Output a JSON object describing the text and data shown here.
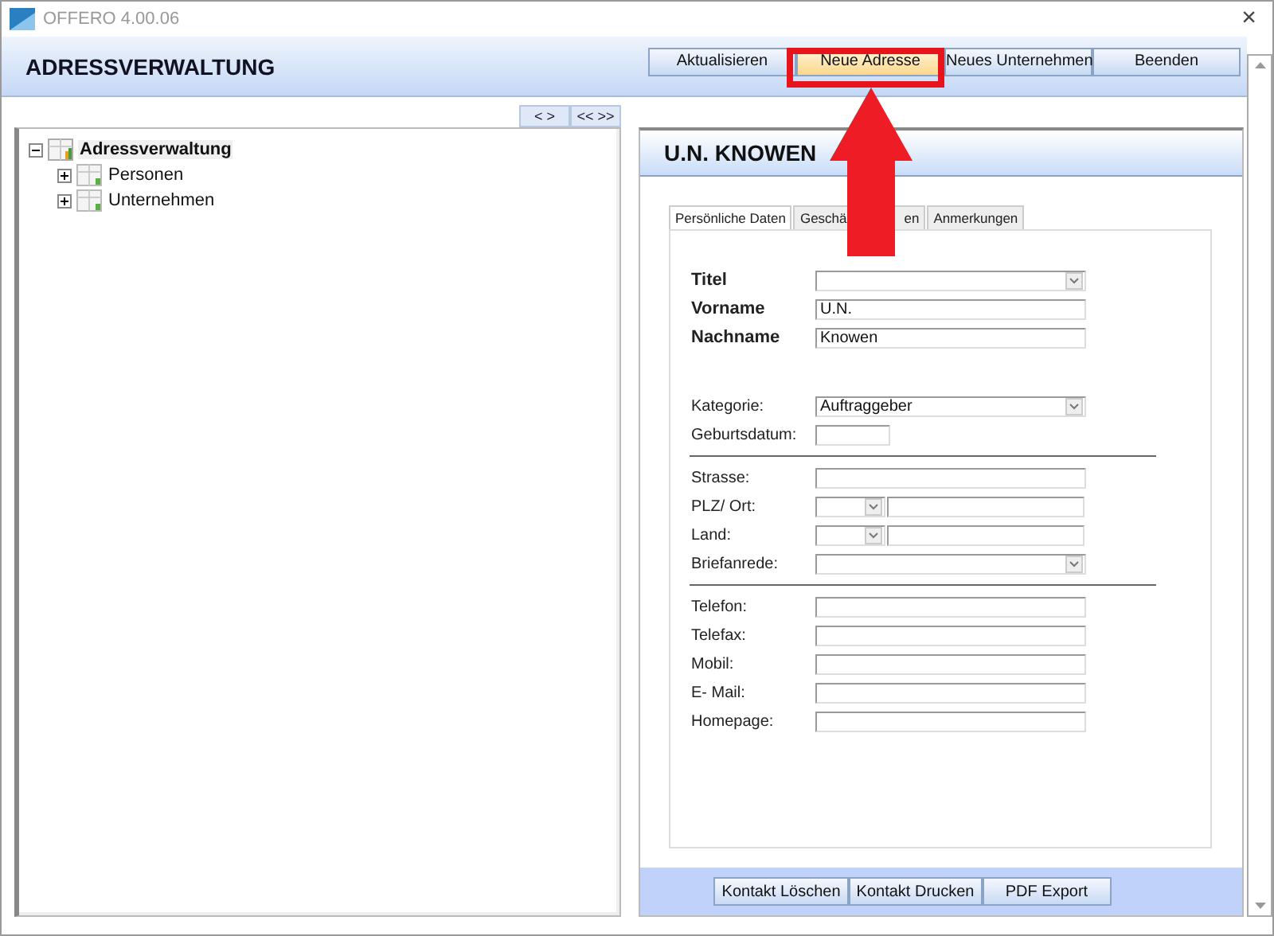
{
  "window": {
    "title": "OFFERO 4.00.06",
    "close": "×"
  },
  "header": {
    "title": "ADRESSVERWALTUNG"
  },
  "toolbar": [
    {
      "label": "Aktualisieren",
      "highlighted": false
    },
    {
      "label": "Neue Adresse",
      "highlighted": true
    },
    {
      "label": "Neues Unternehmen",
      "highlighted": false
    },
    {
      "label": "Beenden",
      "highlighted": false
    }
  ],
  "tree_buttons": [
    "< >",
    "<< >>"
  ],
  "tree": [
    {
      "label": "Adressverwaltung",
      "expanded": true,
      "selected": true,
      "children": [
        {
          "label": "Personen",
          "expanded": false,
          "selected": false
        },
        {
          "label": "Unternehmen",
          "expanded": false,
          "selected": false
        }
      ]
    }
  ],
  "detail": {
    "title": "U.N. KNOWEN",
    "tabs": [
      {
        "label": "Persönliche Daten",
        "selected": true
      },
      {
        "label": "Geschä",
        "label_end": "en",
        "selected": false
      },
      {
        "label": "Anmerkungen",
        "selected": false
      }
    ],
    "sections": [
      {
        "kind": "plain",
        "rows": [
          {
            "label": "Titel",
            "bold": true,
            "kind": "select"
          },
          {
            "label": "Vorname",
            "bold": true,
            "kind": "text",
            "value": "U.N."
          },
          {
            "label": "Nachname",
            "bold": true,
            "kind": "text",
            "value": "Knowen"
          }
        ]
      },
      {
        "kind": "spaced",
        "rows": [
          {
            "label": "Kategorie:",
            "bold": false,
            "kind": "select",
            "value": "Auftraggeber"
          },
          {
            "label": "Geburtsdatum:",
            "bold": false,
            "kind": "short_text"
          }
        ]
      },
      {
        "kind": "ruled",
        "rows": [
          {
            "label": "Strasse:",
            "bold": false,
            "kind": "text"
          },
          {
            "label": "PLZ/ Ort:",
            "bold": false,
            "kind": "combo_text"
          },
          {
            "label": "Land:",
            "bold": false,
            "kind": "combo_text"
          },
          {
            "label": "Briefanrede:",
            "bold": false,
            "kind": "select"
          }
        ]
      },
      {
        "kind": "ruled",
        "rows": [
          {
            "label": "Telefon:",
            "bold": false,
            "kind": "text"
          },
          {
            "label": "Telefax:",
            "bold": false,
            "kind": "text"
          },
          {
            "label": "Mobil:",
            "bold": false,
            "kind": "text"
          },
          {
            "label": "E- Mail:",
            "bold": false,
            "kind": "text"
          },
          {
            "label": "Homepage:",
            "bold": false,
            "kind": "text"
          }
        ]
      }
    ],
    "buttons": [
      "Kontakt Löschen",
      "Kontakt Drucken",
      "PDF Export"
    ]
  },
  "annotation": {
    "kind": "arrow"
  }
}
